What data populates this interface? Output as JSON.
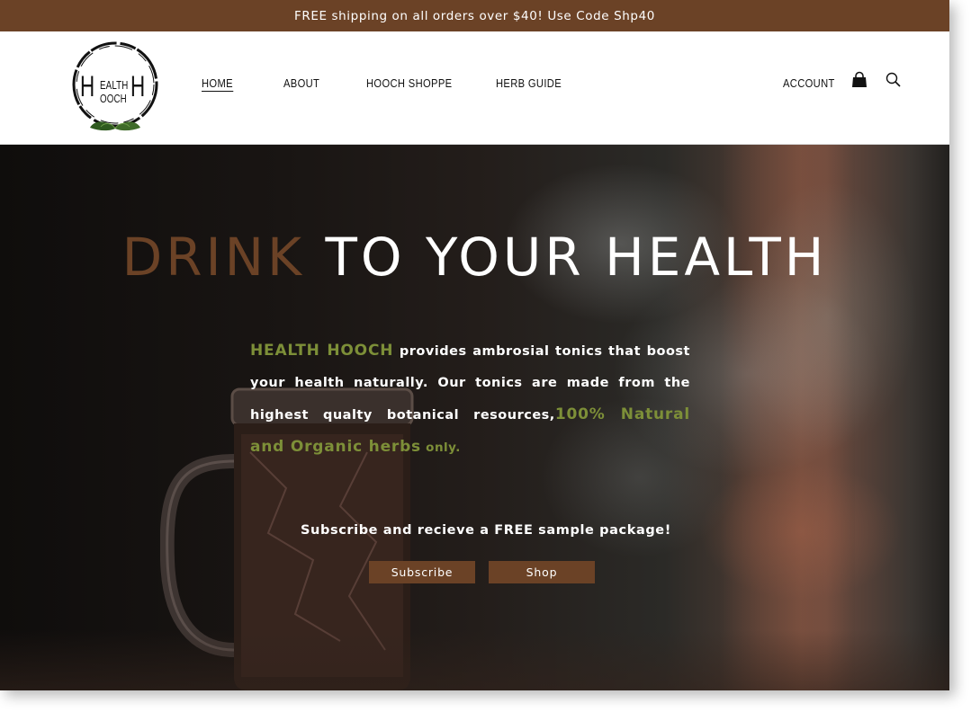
{
  "promo": {
    "text": "FREE shipping on all orders over $40! Use Code Shp40"
  },
  "logo": {
    "big_left": "H",
    "small_top": "EALTH",
    "small_bottom": "OOCH",
    "big_right": "H",
    "leaf_color": "#3f6b2a"
  },
  "nav": {
    "items": [
      {
        "label": "HOME",
        "active": true
      },
      {
        "label": "ABOUT"
      },
      {
        "label": "HOOCH SHOPPE"
      },
      {
        "label": "HERB GUIDE"
      }
    ],
    "account_label": "ACCOUNT",
    "icons": [
      "shopping-bag-icon",
      "search-icon"
    ]
  },
  "hero": {
    "title_accent": "DRINK",
    "title_rest": "TO YOUR HEALTH",
    "copy": {
      "brand": "HEALTH HOOCH",
      "body": " provides ambrosial tonics that boost your health naturally. Our tonics are made from the highest qualty botanical resources,",
      "highlight": "100% Natural and Organic herbs",
      "tail": " only."
    },
    "subscribe_text": "Subscribe and recieve a FREE sample package!",
    "buttons": {
      "subscribe": "Subscribe",
      "shop": "Shop"
    }
  },
  "colors": {
    "brand_brown": "#6b4226",
    "accent_green": "#7d8f38",
    "text_white": "#ffffff"
  }
}
